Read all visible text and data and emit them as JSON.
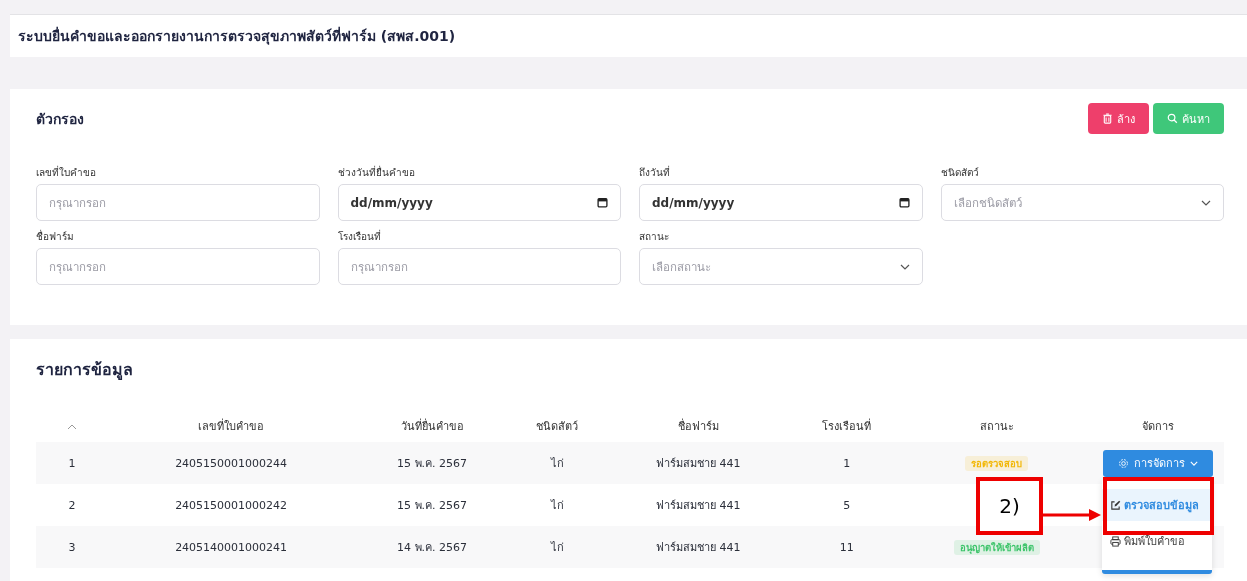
{
  "page_title": "ระบบยื่นคำขอและออกรายงานการตรวจสุขภาพสัตว์ที่ฟาร์ม (สพส.001)",
  "filter": {
    "title": "ตัวกรอง",
    "buttons": [
      {
        "label": "ล้าง",
        "kind": "clear"
      },
      {
        "label": "ค้นหา",
        "kind": "search"
      }
    ],
    "fields": [
      {
        "label": "เลขที่ใบคำขอ",
        "kind": "text",
        "placeholder": "กรุณากรอก"
      },
      {
        "label": "ช่วงวันที่ยื่นคำขอ",
        "kind": "date",
        "value": "dd/mm/yyyy"
      },
      {
        "label": "ถึงวันที่",
        "kind": "date",
        "value": "dd/mm/yyyy"
      },
      {
        "label": "ชนิดสัตว์",
        "kind": "select",
        "placeholder": "เลือกชนิดสัตว์"
      },
      {
        "label": "ชื่อฟาร์ม",
        "kind": "text",
        "placeholder": "กรุณากรอก"
      },
      {
        "label": "โรงเรือนที่",
        "kind": "text",
        "placeholder": "กรุณากรอก"
      },
      {
        "label": "สถานะ",
        "kind": "select",
        "placeholder": "เลือกสถานะ"
      }
    ]
  },
  "table": {
    "title": "รายการข้อมูล",
    "columns": [
      "เลขที่ใบคำขอ",
      "วันที่ยื่นคำขอ",
      "ชนิดสัตว์",
      "ชื่อฟาร์ม",
      "โรงเรือนที่",
      "สถานะ",
      "จัดการ"
    ],
    "rows": [
      {
        "no": "1",
        "request_no": "2405150001000244",
        "date": "15 พ.ค. 2567",
        "animal": "ไก่",
        "farm": "ฟาร์มสมชาย 441",
        "house": "1",
        "status": {
          "label": "รอตรวจสอบ",
          "color": "#f2b705"
        }
      },
      {
        "no": "2",
        "request_no": "2405150001000242",
        "date": "15 พ.ค. 2567",
        "animal": "ไก่",
        "farm": "ฟาร์มสมชาย 441",
        "house": "5"
      },
      {
        "no": "3",
        "request_no": "2405140001000241",
        "date": "14 พ.ค. 2567",
        "animal": "ไก่",
        "farm": "ฟาร์มสมชาย 441",
        "house": "11",
        "status": {
          "label": "อนุญาตให้เข้าผลิต",
          "color": "#3cc46a"
        }
      }
    ],
    "action_menu": {
      "button": "การจัดการ",
      "items": [
        {
          "label": "ตรวจสอบข้อมูล",
          "kind": "edit",
          "selected": true
        },
        {
          "label": "พิมพ์ใบคำขอ",
          "kind": "print",
          "selected": false
        }
      ]
    }
  },
  "annotation": {
    "label": "2)"
  }
}
